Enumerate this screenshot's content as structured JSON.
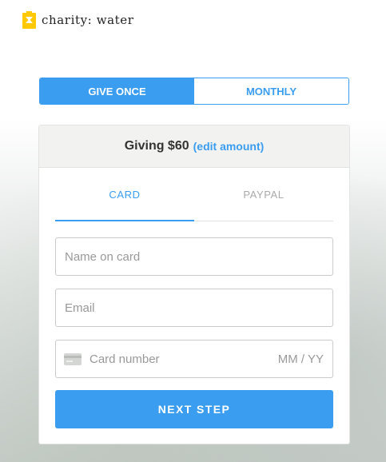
{
  "brand": {
    "name": "charity: water",
    "color": "#ffc907"
  },
  "accent_color": "#3a9df0",
  "frequency": {
    "options": [
      {
        "label": "GIVE ONCE",
        "selected": true
      },
      {
        "label": "MONTHLY",
        "selected": false
      }
    ]
  },
  "summary": {
    "giving_label": "Giving $60",
    "edit_label": "(edit amount)"
  },
  "payment_tabs": [
    {
      "label": "CARD",
      "selected": true
    },
    {
      "label": "PAYPAL",
      "selected": false
    }
  ],
  "form": {
    "name_placeholder": "Name on card",
    "email_placeholder": "Email",
    "card_icon": "credit-card-icon",
    "card_number_placeholder": "Card number",
    "expiry_placeholder": "MM / YY",
    "submit_label": "NEXT STEP"
  }
}
